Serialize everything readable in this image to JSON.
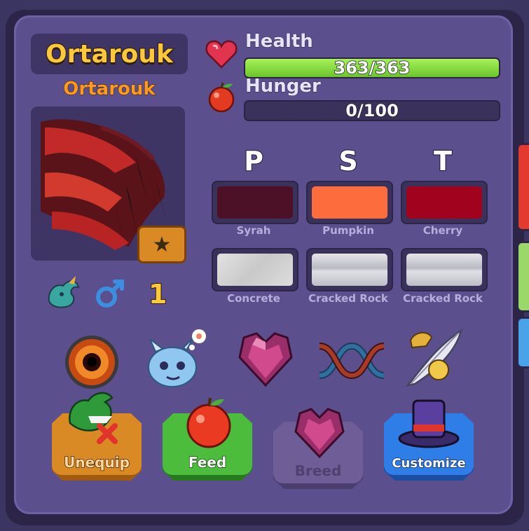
{
  "creature": {
    "name": "Ortarouk",
    "species": "Ortarouk",
    "level": "1"
  },
  "stats": {
    "health": {
      "label": "Health",
      "value": "363/363",
      "fraction": 1.0
    },
    "hunger": {
      "label": "Hunger",
      "value": "0/100",
      "fraction": 0.0
    }
  },
  "colors": {
    "headers": [
      "P",
      "S",
      "T"
    ],
    "colors": [
      {
        "name": "Syrah",
        "hex": "#4d1127"
      },
      {
        "name": "Pumpkin",
        "hex": "#fd6c3c"
      },
      {
        "name": "Cherry",
        "hex": "#a1031e"
      }
    ],
    "materials": [
      {
        "name": "Concrete"
      },
      {
        "name": "Cracked Rock"
      },
      {
        "name": "Cracked Rock"
      }
    ]
  },
  "icons": {
    "row": [
      "eye-icon",
      "baby-dragon-thinking-icon",
      "heart-gem-icon",
      "dna-icon",
      "feather-quill-icon"
    ],
    "info": [
      "dragon-species-icon",
      "male-icon"
    ]
  },
  "actions": {
    "unequip": "Unequip",
    "feed": "Feed",
    "breed": "Breed",
    "customize": "Customize"
  }
}
